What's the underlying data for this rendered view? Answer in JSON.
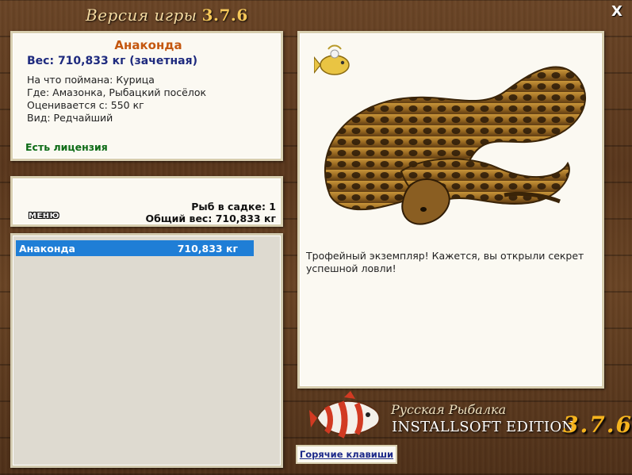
{
  "window": {
    "title": "Версия игры",
    "version": "3.7.6",
    "close_label": "X"
  },
  "fish_info": {
    "name": "Анаконда",
    "weight_line": "Вес: 710,833 кг (зачетная)",
    "caught_on": "На что поймана: Курица",
    "location": "Где: Амазонка, Рыбацкий посёлок",
    "rated_from": "Оценивается с: 550 кг",
    "type": "Вид: Редчайший",
    "license": "Есть лицензия"
  },
  "keep_net": {
    "menu_label": "МЕНЮ",
    "fish_count": "Рыб в садке: 1",
    "total_weight": "Общий вес: 710,833 кг"
  },
  "catch_list": [
    {
      "name": "Анаконда",
      "weight": "710,833 кг"
    }
  ],
  "trophy": {
    "message": "Трофейный экземпляр! Кажется, вы открыли секрет успешной ловли!"
  },
  "brand": {
    "subtitle": "Русская Рыбалка",
    "edition": "INSTALLSOFT EDITION",
    "version": "3.7.6"
  },
  "hotkeys_label": "Горячие клавиши",
  "colors": {
    "accent_name": "#c4570f",
    "weight_text": "#1e2a7e",
    "license_text": "#0d6b16",
    "selection": "#1f7ed6",
    "brand_version": "#f6b41e"
  }
}
